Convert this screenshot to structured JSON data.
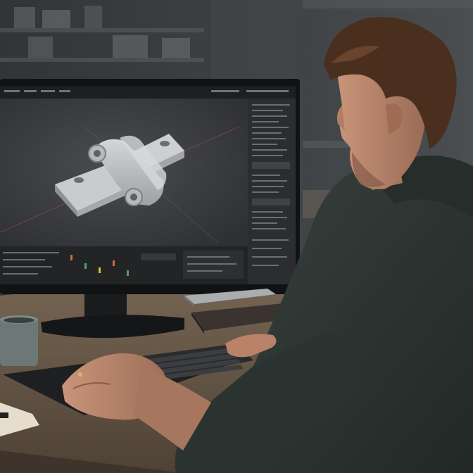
{
  "scene": {
    "type": "photo",
    "subject": "person-at-desk-with-monitor",
    "screen_app": "3d-modeling-software",
    "model": "hinge-bracket",
    "colors": {
      "wall": "#3a3d3f",
      "desk": "#6b5a4a",
      "monitor_bezel": "#111213",
      "viewport": "#3c3e41",
      "hoodie": "#2d3533",
      "skin": "#b8836a",
      "hair": "#4a2f1f",
      "model_gray": "#bfc2c4",
      "mug": "#6c7878"
    }
  }
}
